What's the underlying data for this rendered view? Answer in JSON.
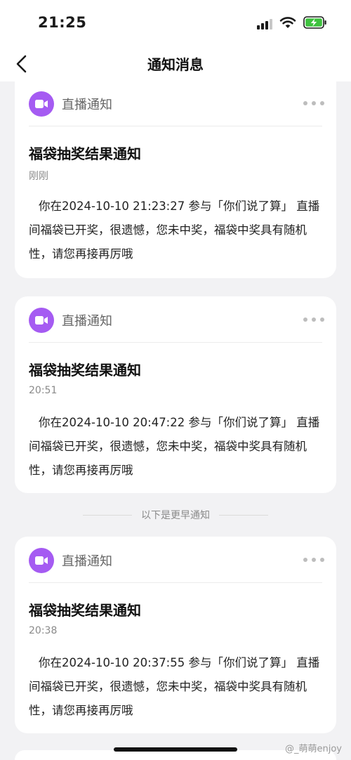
{
  "status_bar": {
    "time": "21:25",
    "signal_icon": "cellular-signal-icon",
    "wifi_icon": "wifi-icon",
    "battery_icon": "battery-charging-icon",
    "battery_color": "#3fc23f"
  },
  "header": {
    "back_icon": "chevron-left-icon",
    "title": "通知消息"
  },
  "colors": {
    "accent": "#a55bf2",
    "background": "#f2f2f4"
  },
  "notifications": [
    {
      "category": "直播通知",
      "title": "福袋抽奖结果通知",
      "time": "刚刚",
      "body": "你在2024-10-10 21:23:27 参与「你们说了算」 直播间福袋已开奖，很遗憾，您未中奖，福袋中奖具有随机性，请您再接再厉哦"
    },
    {
      "category": "直播通知",
      "title": "福袋抽奖结果通知",
      "time": "20:51",
      "body": "你在2024-10-10 20:47:22 参与「你们说了算」 直播间福袋已开奖，很遗憾，您未中奖，福袋中奖具有随机性，请您再接再厉哦"
    },
    {
      "category": "直播通知",
      "title": "福袋抽奖结果通知",
      "time": "20:38",
      "body": "你在2024-10-10 20:37:55 参与「你们说了算」 直播间福袋已开奖，很遗憾，您未中奖，福袋中奖具有随机性，请您再接再厉哦"
    }
  ],
  "separator_label": "以下是更早通知",
  "watermark": "@_萌萌enjoy"
}
